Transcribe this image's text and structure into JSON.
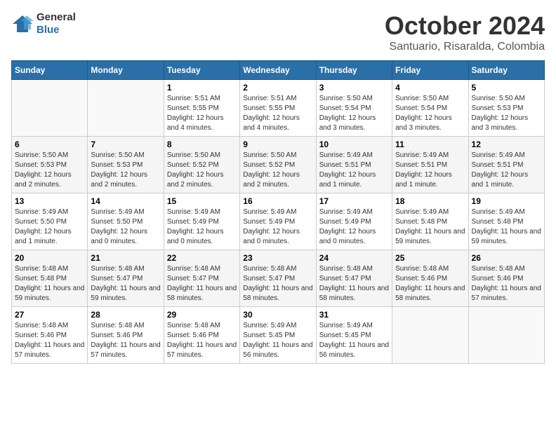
{
  "header": {
    "logo_general": "General",
    "logo_blue": "Blue",
    "month_title": "October 2024",
    "location": "Santuario, Risaralda, Colombia"
  },
  "weekdays": [
    "Sunday",
    "Monday",
    "Tuesday",
    "Wednesday",
    "Thursday",
    "Friday",
    "Saturday"
  ],
  "weeks": [
    [
      {
        "day": "",
        "info": ""
      },
      {
        "day": "",
        "info": ""
      },
      {
        "day": "1",
        "info": "Sunrise: 5:51 AM\nSunset: 5:55 PM\nDaylight: 12 hours and 4 minutes."
      },
      {
        "day": "2",
        "info": "Sunrise: 5:51 AM\nSunset: 5:55 PM\nDaylight: 12 hours and 4 minutes."
      },
      {
        "day": "3",
        "info": "Sunrise: 5:50 AM\nSunset: 5:54 PM\nDaylight: 12 hours and 3 minutes."
      },
      {
        "day": "4",
        "info": "Sunrise: 5:50 AM\nSunset: 5:54 PM\nDaylight: 12 hours and 3 minutes."
      },
      {
        "day": "5",
        "info": "Sunrise: 5:50 AM\nSunset: 5:53 PM\nDaylight: 12 hours and 3 minutes."
      }
    ],
    [
      {
        "day": "6",
        "info": "Sunrise: 5:50 AM\nSunset: 5:53 PM\nDaylight: 12 hours and 2 minutes."
      },
      {
        "day": "7",
        "info": "Sunrise: 5:50 AM\nSunset: 5:53 PM\nDaylight: 12 hours and 2 minutes."
      },
      {
        "day": "8",
        "info": "Sunrise: 5:50 AM\nSunset: 5:52 PM\nDaylight: 12 hours and 2 minutes."
      },
      {
        "day": "9",
        "info": "Sunrise: 5:50 AM\nSunset: 5:52 PM\nDaylight: 12 hours and 2 minutes."
      },
      {
        "day": "10",
        "info": "Sunrise: 5:49 AM\nSunset: 5:51 PM\nDaylight: 12 hours and 1 minute."
      },
      {
        "day": "11",
        "info": "Sunrise: 5:49 AM\nSunset: 5:51 PM\nDaylight: 12 hours and 1 minute."
      },
      {
        "day": "12",
        "info": "Sunrise: 5:49 AM\nSunset: 5:51 PM\nDaylight: 12 hours and 1 minute."
      }
    ],
    [
      {
        "day": "13",
        "info": "Sunrise: 5:49 AM\nSunset: 5:50 PM\nDaylight: 12 hours and 1 minute."
      },
      {
        "day": "14",
        "info": "Sunrise: 5:49 AM\nSunset: 5:50 PM\nDaylight: 12 hours and 0 minutes."
      },
      {
        "day": "15",
        "info": "Sunrise: 5:49 AM\nSunset: 5:49 PM\nDaylight: 12 hours and 0 minutes."
      },
      {
        "day": "16",
        "info": "Sunrise: 5:49 AM\nSunset: 5:49 PM\nDaylight: 12 hours and 0 minutes."
      },
      {
        "day": "17",
        "info": "Sunrise: 5:49 AM\nSunset: 5:49 PM\nDaylight: 12 hours and 0 minutes."
      },
      {
        "day": "18",
        "info": "Sunrise: 5:49 AM\nSunset: 5:48 PM\nDaylight: 11 hours and 59 minutes."
      },
      {
        "day": "19",
        "info": "Sunrise: 5:49 AM\nSunset: 5:48 PM\nDaylight: 11 hours and 59 minutes."
      }
    ],
    [
      {
        "day": "20",
        "info": "Sunrise: 5:48 AM\nSunset: 5:48 PM\nDaylight: 11 hours and 59 minutes."
      },
      {
        "day": "21",
        "info": "Sunrise: 5:48 AM\nSunset: 5:47 PM\nDaylight: 11 hours and 59 minutes."
      },
      {
        "day": "22",
        "info": "Sunrise: 5:48 AM\nSunset: 5:47 PM\nDaylight: 11 hours and 58 minutes."
      },
      {
        "day": "23",
        "info": "Sunrise: 5:48 AM\nSunset: 5:47 PM\nDaylight: 11 hours and 58 minutes."
      },
      {
        "day": "24",
        "info": "Sunrise: 5:48 AM\nSunset: 5:47 PM\nDaylight: 11 hours and 58 minutes."
      },
      {
        "day": "25",
        "info": "Sunrise: 5:48 AM\nSunset: 5:46 PM\nDaylight: 11 hours and 58 minutes."
      },
      {
        "day": "26",
        "info": "Sunrise: 5:48 AM\nSunset: 5:46 PM\nDaylight: 11 hours and 57 minutes."
      }
    ],
    [
      {
        "day": "27",
        "info": "Sunrise: 5:48 AM\nSunset: 5:46 PM\nDaylight: 11 hours and 57 minutes."
      },
      {
        "day": "28",
        "info": "Sunrise: 5:48 AM\nSunset: 5:46 PM\nDaylight: 11 hours and 57 minutes."
      },
      {
        "day": "29",
        "info": "Sunrise: 5:48 AM\nSunset: 5:46 PM\nDaylight: 11 hours and 57 minutes."
      },
      {
        "day": "30",
        "info": "Sunrise: 5:49 AM\nSunset: 5:45 PM\nDaylight: 11 hours and 56 minutes."
      },
      {
        "day": "31",
        "info": "Sunrise: 5:49 AM\nSunset: 5:45 PM\nDaylight: 11 hours and 56 minutes."
      },
      {
        "day": "",
        "info": ""
      },
      {
        "day": "",
        "info": ""
      }
    ]
  ]
}
